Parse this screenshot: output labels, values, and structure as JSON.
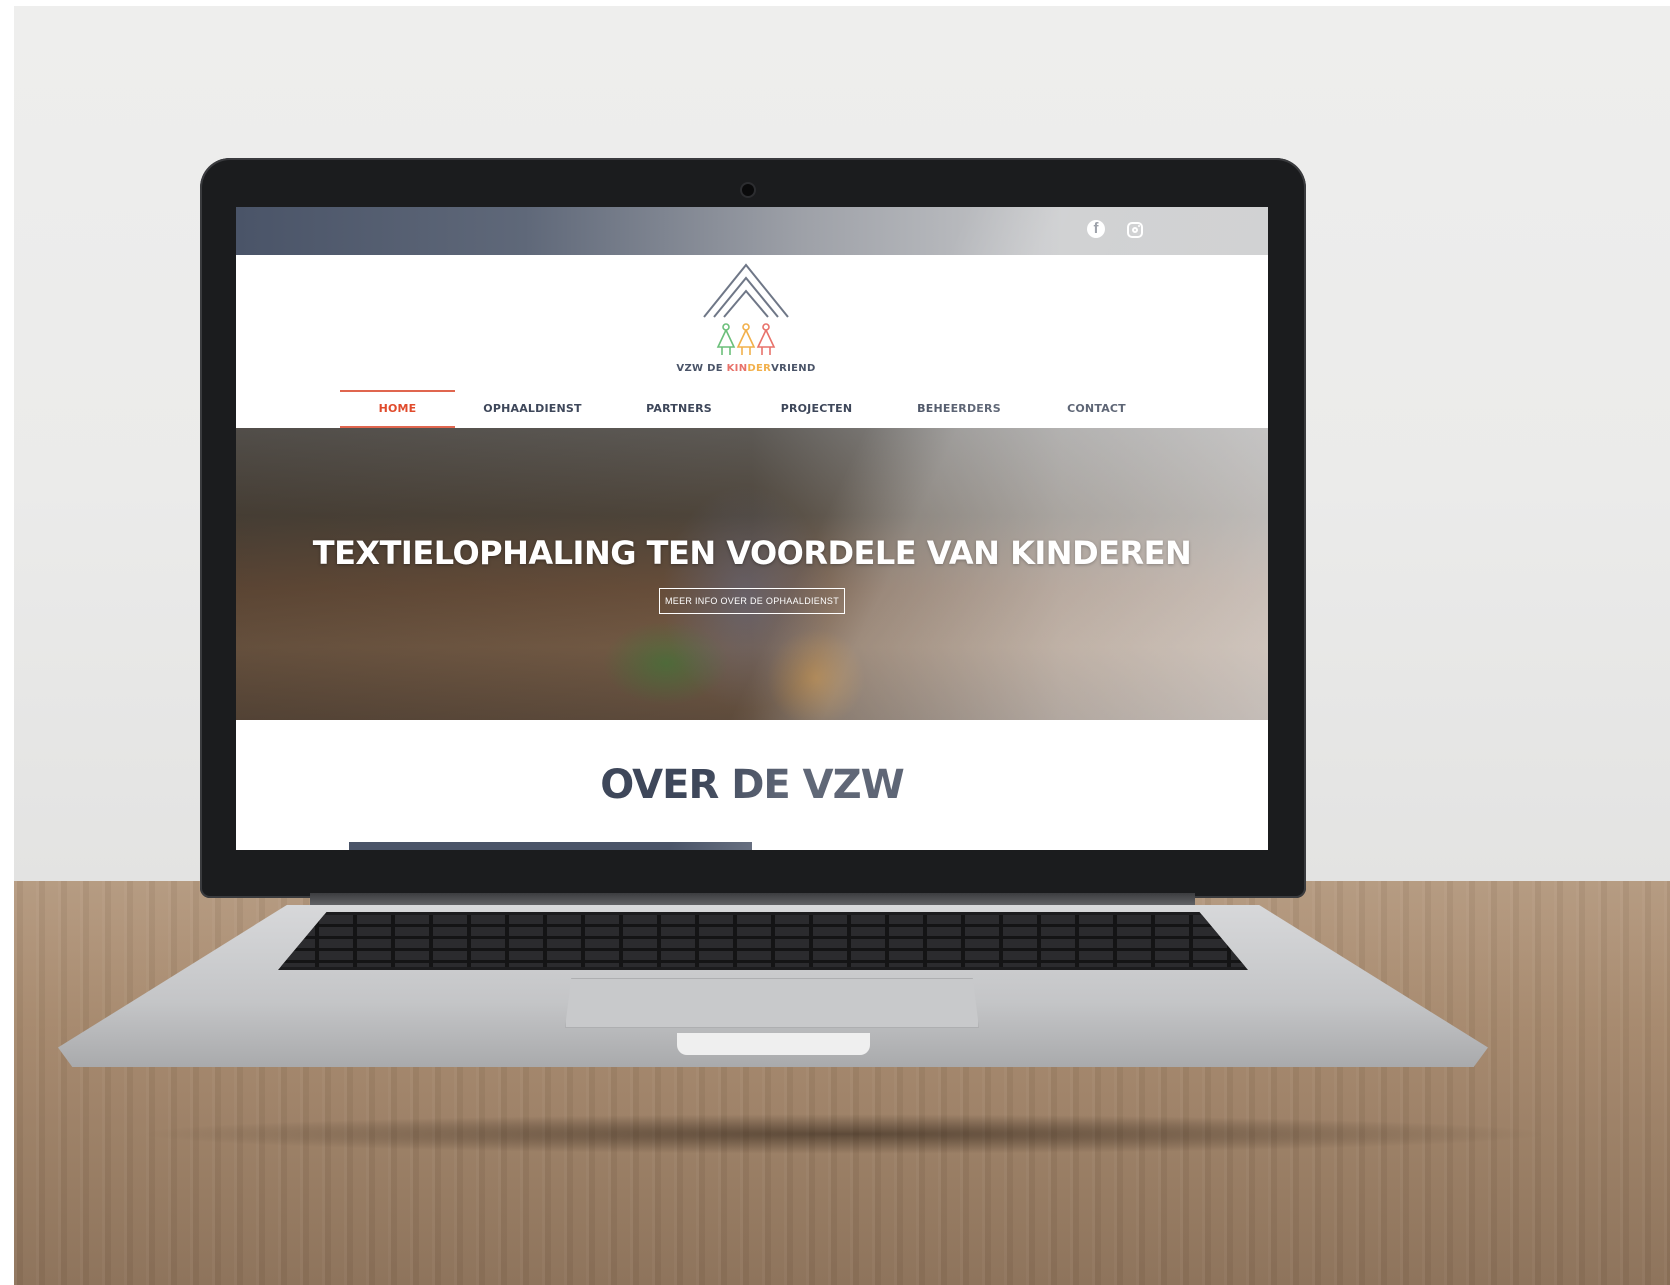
{
  "site": {
    "logo_text_parts": [
      "VZW DE ",
      "KIN",
      "DER",
      "VRIEND"
    ],
    "social": [
      {
        "icon": "facebook-icon",
        "glyph": "f"
      },
      {
        "icon": "instagram-icon"
      }
    ],
    "nav": [
      {
        "label": "HOME",
        "active": true
      },
      {
        "label": "OPHAALDIENST",
        "active": false
      },
      {
        "label": "PARTNERS",
        "active": false
      },
      {
        "label": "PROJECTEN",
        "active": false
      },
      {
        "label": "BEHEERDERS",
        "active": false
      },
      {
        "label": "CONTACT",
        "active": false
      }
    ],
    "hero": {
      "title": "TEXTIELOPHALING TEN VOORDELE VAN KINDEREN",
      "button_label": "MEER INFO OVER DE OPHAALDIENST"
    },
    "section_title": "OVER DE VZW"
  },
  "colors": {
    "accent": "#e04b2c",
    "navy": "#3e475a",
    "topbar": "#4a5468"
  }
}
